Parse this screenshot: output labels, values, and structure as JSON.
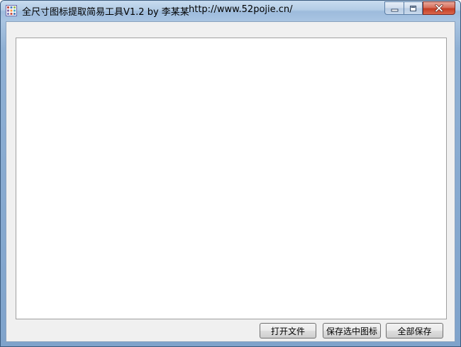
{
  "window": {
    "title": "全尺寸图标提取简易工具V1.2 by 李某某",
    "url": "http://www.52pojie.cn/"
  },
  "caption": {
    "minimize_icon": "minimize-icon",
    "maximize_icon": "maximize-icon",
    "close_icon": "close-icon"
  },
  "buttons": {
    "open_file": "打开文件",
    "save_selected": "保存选中图标",
    "save_all": "全部保存"
  }
}
